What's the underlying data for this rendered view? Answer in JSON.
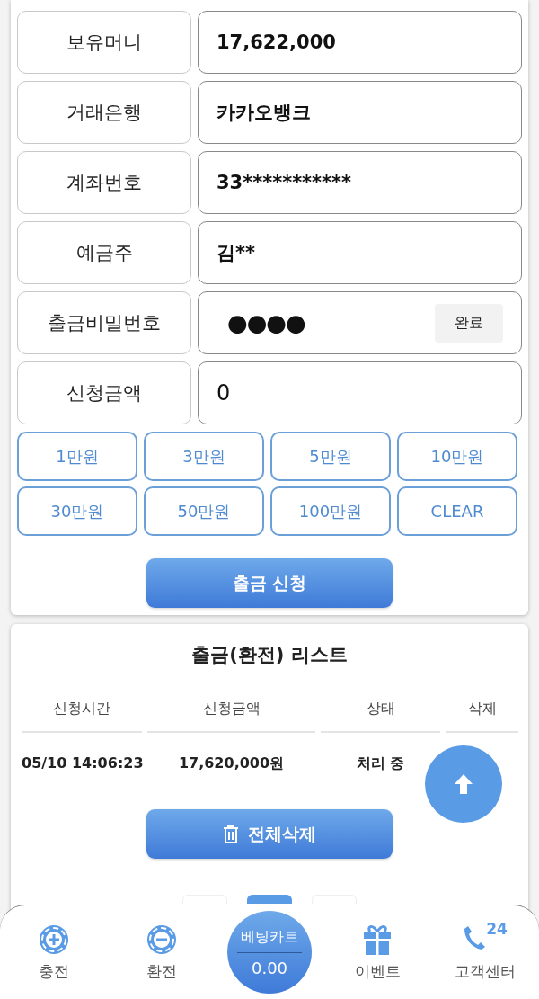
{
  "form": {
    "rows": [
      {
        "label": "보유머니",
        "kind": "text",
        "value": "17,622,000"
      },
      {
        "label": "거래은행",
        "kind": "text",
        "value": "카카오뱅크"
      },
      {
        "label": "계좌번호",
        "kind": "text",
        "value": "33***********"
      },
      {
        "label": "예금주",
        "kind": "text",
        "value": "김**"
      },
      {
        "label": "출금비밀번호",
        "kind": "password",
        "value": "●●●●",
        "action": "완료"
      },
      {
        "label": "신청금액",
        "kind": "amount",
        "value": "0"
      }
    ],
    "amount_buttons": [
      "1만원",
      "3만원",
      "5만원",
      "10만원",
      "30만원",
      "50만원",
      "100만원",
      "CLEAR"
    ],
    "submit": "출금 신청"
  },
  "list": {
    "title": "출금(환전) 리스트",
    "columns": [
      "신청시간",
      "신청금액",
      "상태",
      "삭제"
    ],
    "rows": [
      {
        "time": "05/10 14:06:23",
        "amount": "17,620,000원",
        "status": "처리 중"
      }
    ],
    "delete_all": "전체삭제",
    "pagination": [
      {
        "selected": false
      },
      {
        "selected": true
      },
      {
        "selected": false
      }
    ]
  },
  "bottom_nav": [
    {
      "kind": "charge",
      "label": "충전"
    },
    {
      "kind": "exchange",
      "label": "환전"
    },
    {
      "kind": "cart",
      "label": "베팅카트",
      "value": "0.00"
    },
    {
      "kind": "event",
      "label": "이벤트"
    },
    {
      "kind": "support",
      "label": "고객센터",
      "badge": "24"
    }
  ]
}
